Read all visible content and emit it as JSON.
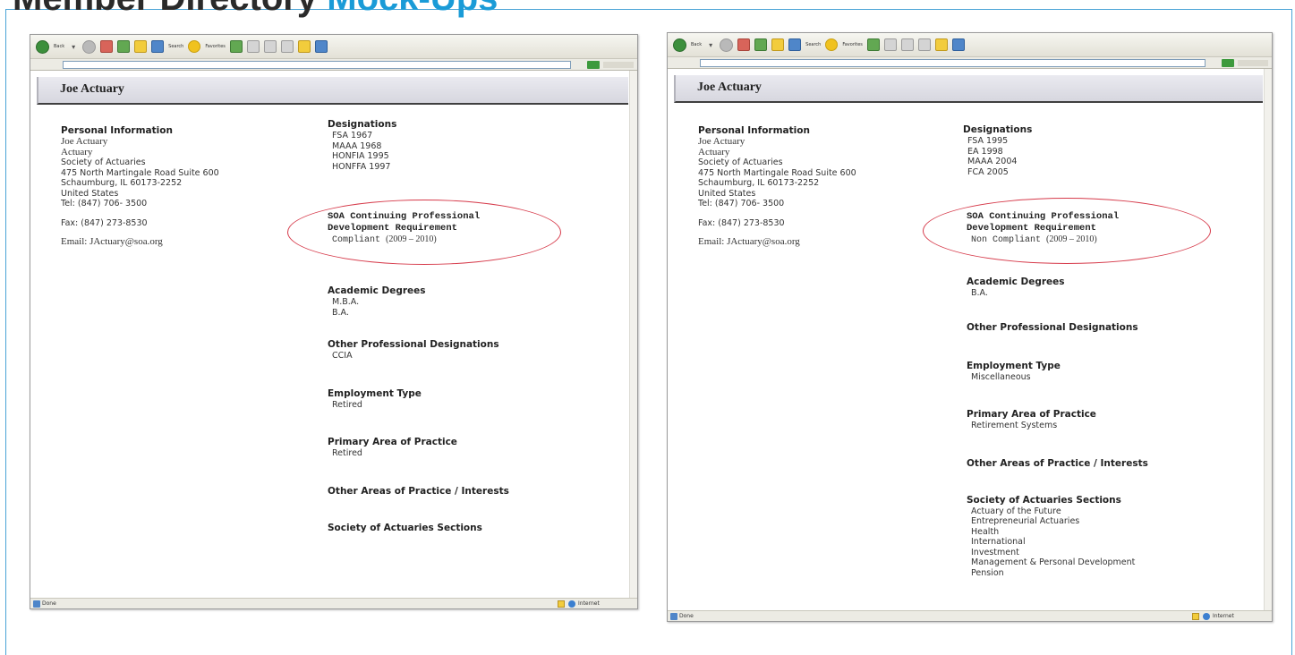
{
  "page_heading": {
    "dark": "Member Directory",
    "blue": "Mock-Ups"
  },
  "browser": {
    "status": "Done",
    "zone": "Internet",
    "toolbar": {
      "back": "Back",
      "search": "Search",
      "favorites": "Favorites"
    }
  },
  "left": {
    "name": "Joe Actuary",
    "personal_info": {
      "title": "Personal Information",
      "name": "Joe Actuary",
      "role": "Actuary",
      "org": "Society of Actuaries",
      "address": "475 North Martingale Road Suite 600",
      "city": "Schaumburg, IL 60173-2252",
      "country": "United States",
      "tel": "Tel: (847) 706- 3500",
      "fax": "Fax: (847) 273-8530",
      "email": "Email: JActuary@soa.org"
    },
    "designations": {
      "title": "Designations",
      "items": [
        "FSA 1967",
        "MAAA 1968",
        "HONFIA 1995",
        "HONFFA 1997"
      ]
    },
    "cpd": {
      "title_line1": "SOA Continuing Professional",
      "title_line2": "Development Requirement",
      "status": "Compliant",
      "period": "(2009 – 2010)"
    },
    "academic": {
      "title": "Academic Degrees",
      "items": [
        "M.B.A.",
        "B.A."
      ]
    },
    "other_designations": {
      "title": "Other Professional Designations",
      "items": [
        "CCIA"
      ]
    },
    "employment": {
      "title": "Employment Type",
      "value": "Retired"
    },
    "primary_area": {
      "title": "Primary Area of Practice",
      "value": "Retired"
    },
    "other_areas": {
      "title": "Other Areas of Practice / Interests"
    },
    "sections": {
      "title": "Society of Actuaries Sections"
    }
  },
  "right": {
    "name": "Joe Actuary",
    "personal_info": {
      "title": "Personal Information",
      "name": "Joe Actuary",
      "role": "Actuary",
      "org": "Society of Actuaries",
      "address": "475 North Martingale Road Suite 600",
      "city": "Schaumburg, IL 60173-2252",
      "country": "United States",
      "tel": "Tel: (847) 706- 3500",
      "fax": "Fax: (847) 273-8530",
      "email": "Email: JActuary@soa.org"
    },
    "designations": {
      "title": "Designations",
      "items": [
        "FSA 1995",
        "EA 1998",
        "MAAA 2004",
        "FCA 2005"
      ]
    },
    "cpd": {
      "title_line1": "SOA Continuing Professional",
      "title_line2": "Development Requirement",
      "status": "Non Compliant",
      "period": "(2009 – 2010)"
    },
    "academic": {
      "title": "Academic Degrees",
      "items": [
        "B.A."
      ]
    },
    "other_designations": {
      "title": "Other Professional Designations"
    },
    "employment": {
      "title": "Employment Type",
      "value": "Miscellaneous"
    },
    "primary_area": {
      "title": "Primary Area of Practice",
      "value": "Retirement Systems"
    },
    "other_areas": {
      "title": "Other Areas of Practice / Interests"
    },
    "sections": {
      "title": "Society of Actuaries Sections",
      "items": [
        "Actuary of the Future",
        "Entrepreneurial Actuaries",
        "Health",
        "International",
        "Investment",
        "Management & Personal Development",
        "Pension"
      ]
    }
  },
  "colors": {
    "brand_blue": "#1a9bd7",
    "ellipse_red": "#d63a4a"
  }
}
